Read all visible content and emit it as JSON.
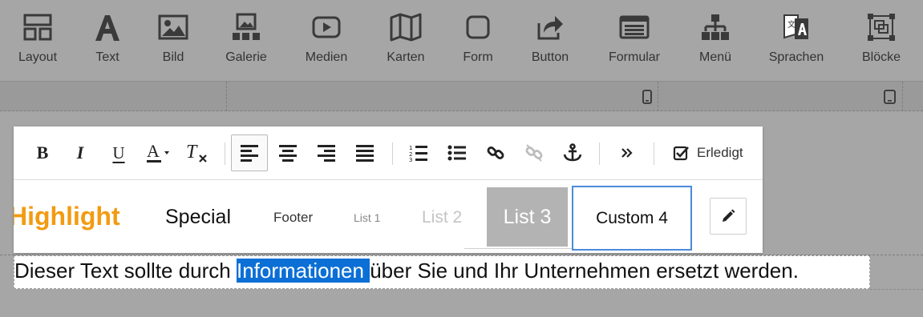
{
  "toolbar": {
    "items": [
      {
        "label": "Layout",
        "icon": "layout-icon"
      },
      {
        "label": "Text",
        "icon": "text-icon"
      },
      {
        "label": "Bild",
        "icon": "image-icon"
      },
      {
        "label": "Galerie",
        "icon": "gallery-icon"
      },
      {
        "label": "Medien",
        "icon": "media-icon"
      },
      {
        "label": "Karten",
        "icon": "map-icon"
      },
      {
        "label": "Form",
        "icon": "shape-icon"
      },
      {
        "label": "Button",
        "icon": "button-icon"
      },
      {
        "label": "Formular",
        "icon": "form-icon"
      },
      {
        "label": "Menü",
        "icon": "menu-icon"
      },
      {
        "label": "Sprachen",
        "icon": "language-icon"
      },
      {
        "label": "Blöcke",
        "icon": "blocks-icon"
      }
    ]
  },
  "editor": {
    "bold": "B",
    "italic": "I",
    "underline": "U",
    "done_label": "Erledigt"
  },
  "styles": {
    "highlight": "Highlight",
    "special": "Special",
    "footer": "Footer",
    "list1": "List 1",
    "list2": "List 2",
    "list3": "List 3",
    "custom4": "Custom 4"
  },
  "content": {
    "before": "Dieser Text sollte durch ",
    "selected": "Informationen ",
    "after": "über Sie und Ihr Unternehmen ersetzt werden."
  },
  "colors": {
    "highlight": "#f29b11",
    "selection": "#0b6fd6",
    "active_style_border": "#4a8bdc"
  }
}
